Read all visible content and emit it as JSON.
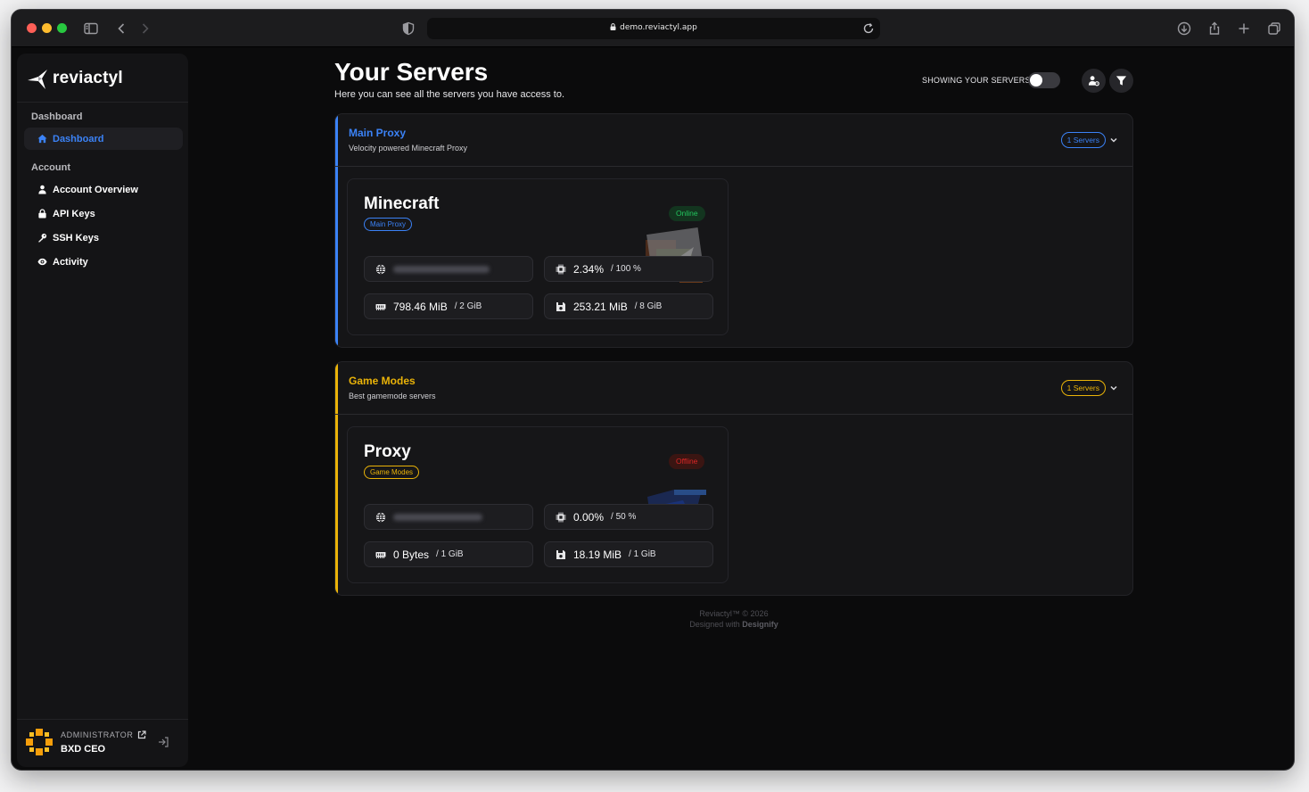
{
  "browser": {
    "url": "demo.reviactyl.app"
  },
  "sidebar": {
    "logo_text": "reviactyl",
    "sections": [
      {
        "title": "Dashboard",
        "items": [
          {
            "label": "Dashboard",
            "icon": "home-icon",
            "active": true
          }
        ]
      },
      {
        "title": "Account",
        "items": [
          {
            "label": "Account Overview",
            "icon": "user-icon"
          },
          {
            "label": "API Keys",
            "icon": "lock-icon"
          },
          {
            "label": "SSH Keys",
            "icon": "key-icon"
          },
          {
            "label": "Activity",
            "icon": "eye-icon"
          }
        ]
      }
    ],
    "user": {
      "role": "ADMINISTRATOR",
      "name": "BXD CEO"
    }
  },
  "main": {
    "title": "Your Servers",
    "subtitle": "Here you can see all the servers you have access to.",
    "toggle_label": "SHOWING YOUR SERVERS",
    "toggle_on": false,
    "groups": [
      {
        "name": "Main Proxy",
        "description": "Velocity powered Minecraft Proxy",
        "count": "1 Servers",
        "color": "#3b82f6",
        "server": {
          "name": "Minecraft",
          "tag": "Main Proxy",
          "status": "Online",
          "cpu": "2.34%",
          "cpu_limit": "/ 100 %",
          "memory": "798.46 MiB",
          "memory_limit": "/ 2 GiB",
          "disk": "253.21 MiB",
          "disk_limit": "/ 8 GiB"
        }
      },
      {
        "name": "Game Modes",
        "description": "Best gamemode servers",
        "count": "1 Servers",
        "color": "#eab308",
        "server": {
          "name": "Proxy",
          "tag": "Game Modes",
          "status": "Offline",
          "cpu": "0.00%",
          "cpu_limit": "/ 50 %",
          "memory": "0 Bytes",
          "memory_limit": "/ 1 GiB",
          "disk": "18.19 MiB",
          "disk_limit": "/ 1 GiB"
        }
      }
    ]
  },
  "footer": {
    "line1": "Reviactyl™ © 2026",
    "line2_prefix": "Designed with",
    "line2_brand": "Designify"
  },
  "colors": {
    "accent_blue": "#3b82f6",
    "accent_yellow": "#eab308",
    "online": "#22c55e",
    "offline": "#dc2626"
  }
}
